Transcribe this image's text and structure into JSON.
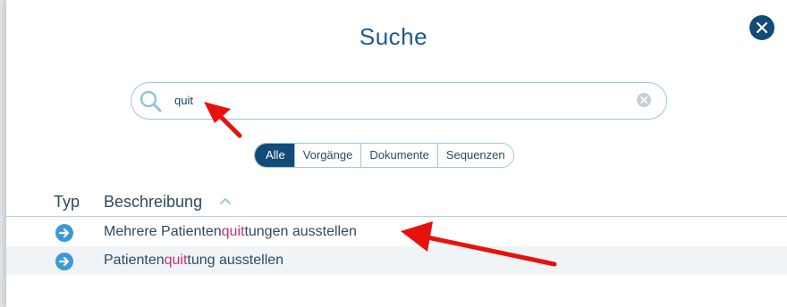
{
  "modal": {
    "title": "Suche"
  },
  "search": {
    "value": "quit",
    "placeholder": ""
  },
  "filters": [
    {
      "label": "Alle",
      "active": true
    },
    {
      "label": "Vorgänge",
      "active": false
    },
    {
      "label": "Dokumente",
      "active": false
    },
    {
      "label": "Sequenzen",
      "active": false
    }
  ],
  "table": {
    "columns": {
      "type": "Typ",
      "description": "Beschreibung"
    },
    "rows": [
      {
        "pre": "Mehrere Patienten",
        "match": "quit",
        "post": "tungen ausstellen"
      },
      {
        "pre": "Patienten",
        "match": "quit",
        "post": "tung ausstellen"
      }
    ]
  },
  "colors": {
    "title": "#1b5a8a",
    "close_button": "#124a78",
    "active_filter": "#124a78",
    "row_icon": "#3a9bd4",
    "highlight": "#c2336f",
    "annotation_arrow": "#e8120c"
  },
  "icons": {
    "close": "close-icon",
    "search": "search-icon",
    "clear": "clear-icon",
    "sort": "chevron-up-icon",
    "row": "arrow-right-circle-icon"
  }
}
